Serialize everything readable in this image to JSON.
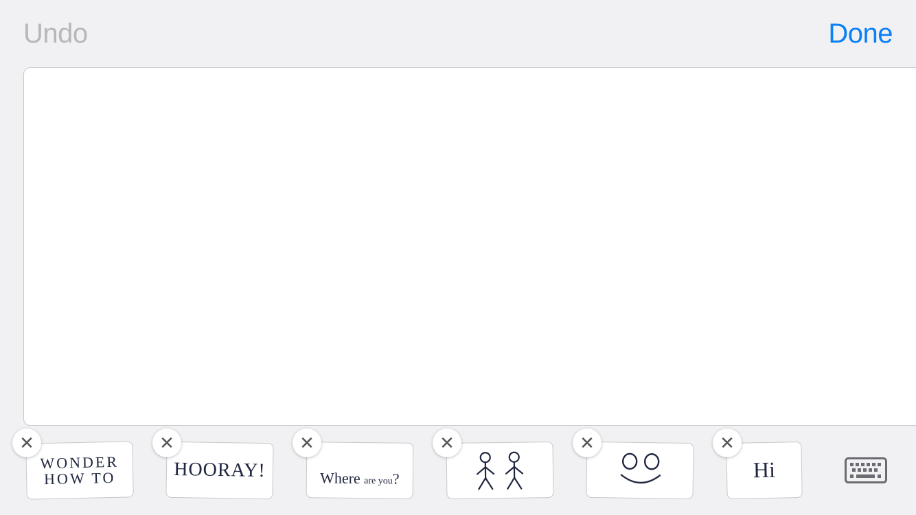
{
  "header": {
    "undo_label": "Undo",
    "done_label": "Done"
  },
  "tray": {
    "items": [
      {
        "id": "wonder-how-to",
        "text": "WONDER\nHOW TO"
      },
      {
        "id": "hooray",
        "text": "HOORAY!"
      },
      {
        "id": "where-are-you",
        "text": "Where are you?"
      },
      {
        "id": "stick-figures",
        "text": ""
      },
      {
        "id": "smiley",
        "text": ""
      },
      {
        "id": "hi",
        "text": "Hi"
      }
    ]
  },
  "icons": {
    "close": "close-icon",
    "keyboard": "keyboard-icon"
  },
  "colors": {
    "accent": "#0a7ff6",
    "disabled": "#b6b6bb",
    "ink": "#202840"
  }
}
